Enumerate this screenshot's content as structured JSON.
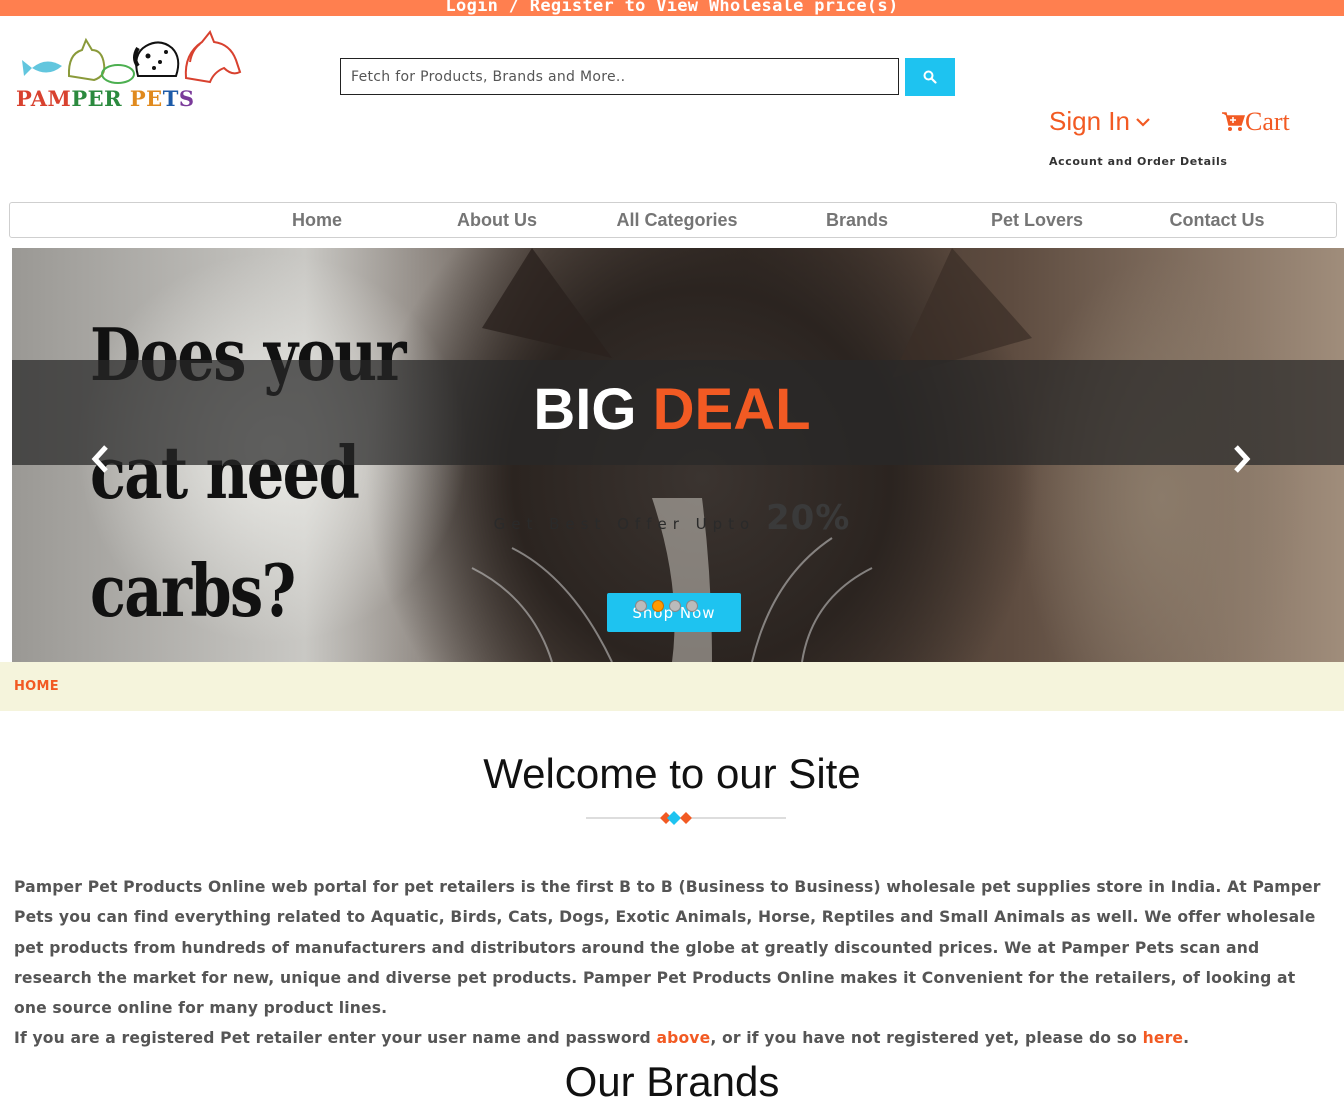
{
  "topbar": {
    "text": "Login / Register to View Wholesale price(s)"
  },
  "logo": {
    "text_parts": [
      "PAM",
      "PER",
      " ",
      "PE",
      "T",
      "S"
    ]
  },
  "search": {
    "placeholder": "Fetch for Products, Brands and More.."
  },
  "header": {
    "signin_label": "Sign In",
    "cart_label": "Cart",
    "account_label": "Account and Order Details"
  },
  "nav": {
    "items": [
      {
        "label": "Home"
      },
      {
        "label": "About Us"
      },
      {
        "label": "All Categories"
      },
      {
        "label": "Brands"
      },
      {
        "label": "Pet Lovers"
      },
      {
        "label": "Contact Us"
      }
    ]
  },
  "hero": {
    "poster_lines": [
      "Does your",
      "cat need",
      "carbs?"
    ],
    "title_white": "BIG",
    "title_accent": "DEAL",
    "offer_text": "Get Best Offer Upto",
    "offer_percent": "20%",
    "button_label": "Shop Now",
    "slide_count": 4,
    "active_slide": 2
  },
  "breadcrumb": {
    "label": "HOME"
  },
  "welcome": {
    "title": "Welcome to our Site",
    "paragraph": "Pamper Pet Products Online web portal for pet retailers is the first B to B (Business to Business) wholesale pet supplies store in India. At Pamper Pets you can find everything related to Aquatic, Birds, Cats, Dogs, Exotic Animals, Horse, Reptiles and Small Animals as well. We offer wholesale pet products from hundreds of manufacturers and distributors around the globe at greatly discounted prices. We at Pamper Pets scan and research the market for new, unique and diverse pet products. Pamper Pet Products Online makes it Convenient for the retailers, of looking at one source online for many product lines.",
    "register_prefix": "If you are a registered Pet retailer enter your user name and password ",
    "above_link": "above",
    "register_middle": ", or if you have not registered yet, please do so ",
    "here_link": "here",
    "register_suffix": "."
  },
  "next_section": {
    "title": "Our Brands"
  },
  "colors": {
    "accent_orange": "#f25a23",
    "topbar": "#ff7f4f",
    "cyan": "#1ec3f0",
    "breadcrumb_bg": "#f5f4dc"
  },
  "icons": {
    "search": "search-icon",
    "chevron": "chevron-down-icon",
    "cart": "cart-icon",
    "prev": "chevron-left-icon",
    "next": "chevron-right-icon"
  }
}
